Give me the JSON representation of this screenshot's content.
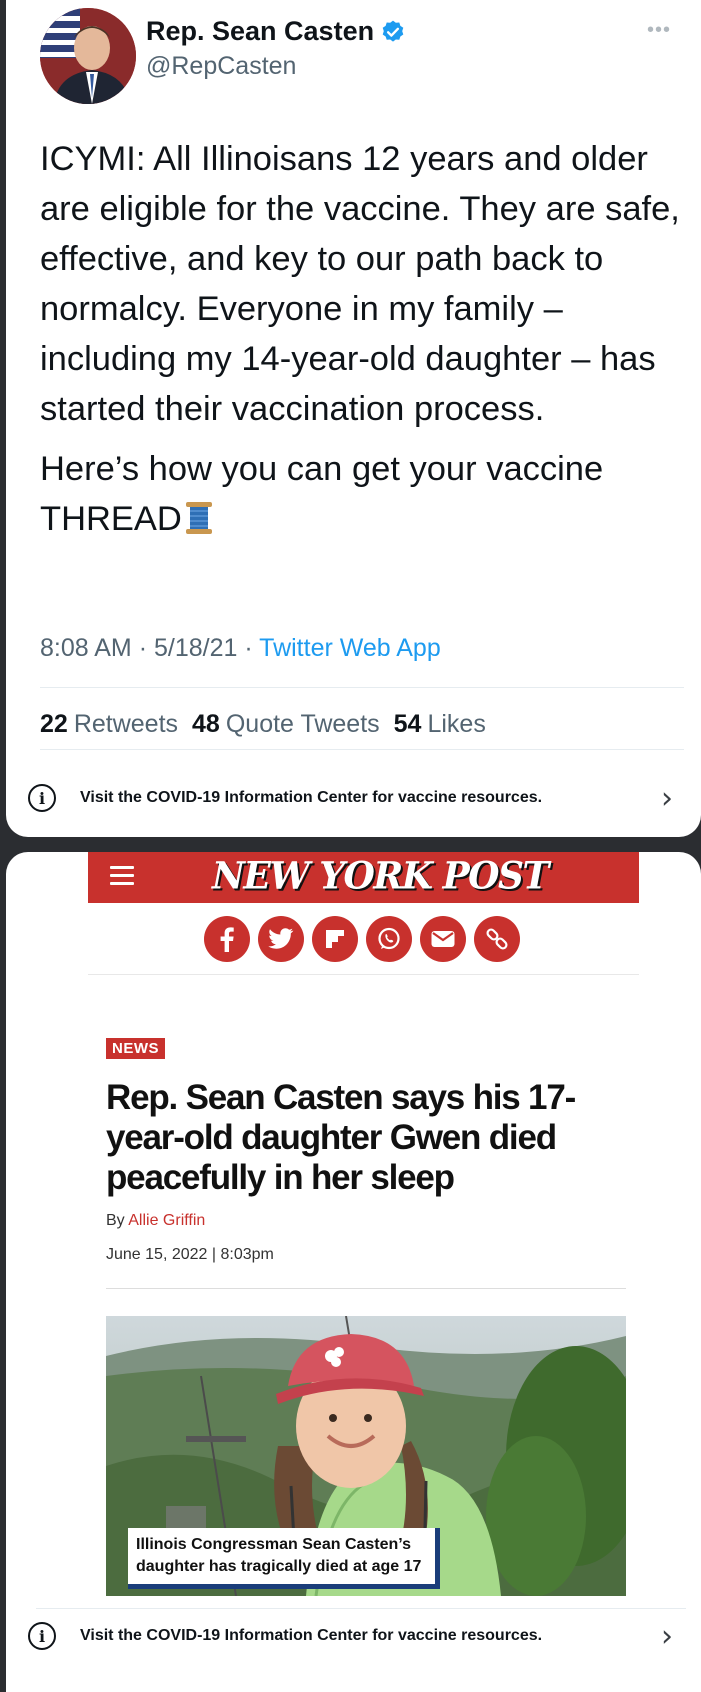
{
  "tweet": {
    "author_name": "Rep. Sean Casten",
    "author_handle": "@RepCasten",
    "more_label": "•••",
    "body_paragraph_1": "ICYMI: All Illinoisans 12 years and older are eligible for the vaccine. They are safe, effective, and key to our path back to normalcy. Everyone in my family – including my 14-year-old daughter – has started their vaccination process.",
    "body_paragraph_2": "Here’s how you can get your vaccine THREAD",
    "time": "8:08 AM",
    "date": "5/18/21",
    "source": "Twitter Web App",
    "retweets_count": "22",
    "retweets_label": "Retweets",
    "quote_count": "48",
    "quote_label": "Quote Tweets",
    "likes_count": "54",
    "likes_label": "Likes",
    "covid_notice": "Visit the COVID-19 Information Center for vaccine resources."
  },
  "article": {
    "publication": "NEW YORK POST",
    "section_tag": "NEWS",
    "headline": "Rep. Sean Casten says his 17-year-old daughter Gwen died peacefully in her sleep",
    "byline_prefix": "By ",
    "author": "Allie Griffin",
    "dateline": "June 15, 2022 | 8:03pm",
    "photo_caption_line_1": "Illinois Congressman Sean Casten’s",
    "photo_caption_line_2": "daughter has tragically died at age 17",
    "share_icons": [
      "facebook-icon",
      "twitter-icon",
      "flipboard-icon",
      "whatsapp-icon",
      "email-icon",
      "link-icon"
    ],
    "covid_notice": "Visit the COVID-19 Information Center for vaccine resources."
  },
  "colors": {
    "twitter_blue": "#1d9bf0",
    "nyp_red": "#c8312d",
    "caption_border": "#1a3d7a"
  }
}
